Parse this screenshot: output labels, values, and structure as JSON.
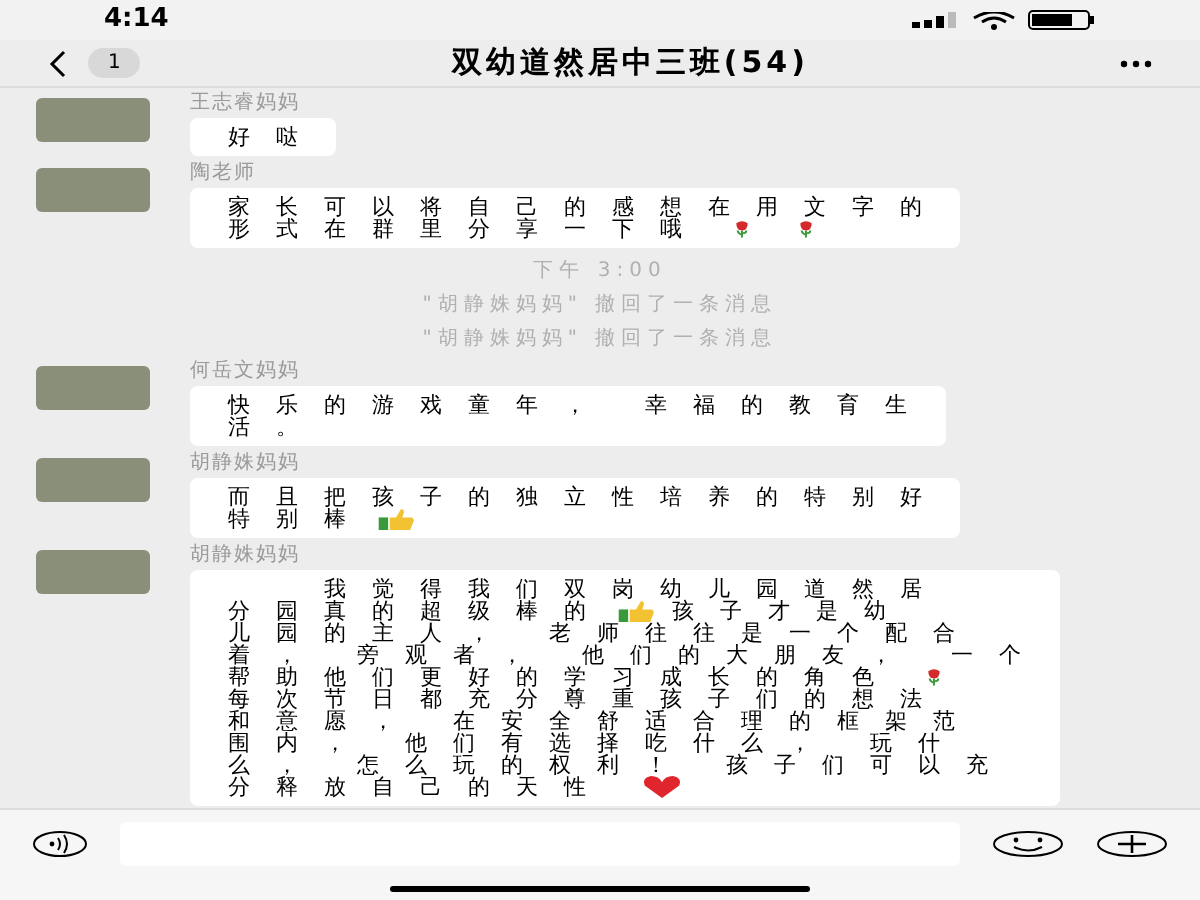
{
  "status_bar": {
    "time": "4:14"
  },
  "header": {
    "back_badge": "1",
    "title": "双幼道然居中三班(54)"
  },
  "messages": [
    {
      "kind": "message",
      "sender": "王志睿妈妈",
      "lines": [
        [
          {
            "kind": "text",
            "text": "好哒"
          }
        ]
      ]
    },
    {
      "kind": "message",
      "sender": "陶老师",
      "lines": [
        [
          {
            "kind": "text",
            "text": "家长可以将自己的感想在用文字的"
          }
        ],
        [
          {
            "kind": "text",
            "text": "形式在群里分享一下哦"
          },
          {
            "kind": "rose"
          },
          {
            "kind": "rose"
          }
        ]
      ]
    },
    {
      "kind": "time",
      "text": "下午 3:00"
    },
    {
      "kind": "notice",
      "text": "\"胡静姝妈妈\" 撤回了一条消息"
    },
    {
      "kind": "notice",
      "text": "\"胡静姝妈妈\" 撤回了一条消息"
    },
    {
      "kind": "message",
      "sender": "何岳文妈妈",
      "lines": [
        [
          {
            "kind": "text",
            "text": "快乐的游戏童年， 幸福的教育生"
          }
        ],
        [
          {
            "kind": "text",
            "text": "活。"
          }
        ]
      ]
    },
    {
      "kind": "message",
      "sender": "胡静姝妈妈",
      "lines": [
        [
          {
            "kind": "text",
            "text": "而且把孩子的独立性培养的特别好"
          }
        ],
        [
          {
            "kind": "text",
            "text": "特别棒"
          },
          {
            "kind": "thumbs"
          }
        ]
      ]
    },
    {
      "kind": "message",
      "sender": "胡静姝妈妈",
      "lines": [
        [
          {
            "kind": "text",
            "text": "　　我觉得我们双岗幼儿园道然居"
          }
        ],
        [
          {
            "kind": "text",
            "text": "分园真的超级棒的"
          },
          {
            "kind": "thumbs"
          },
          {
            "kind": "text",
            "text": "孩子才是幼"
          }
        ],
        [
          {
            "kind": "text",
            "text": "儿园的主人， 老师往往是一个配合"
          }
        ],
        [
          {
            "kind": "text",
            "text": "着， 旁观者， 他们的大朋友， 一个"
          }
        ],
        [
          {
            "kind": "text",
            "text": "帮助他们更好的学习成长的角色"
          },
          {
            "kind": "rose"
          }
        ],
        [
          {
            "kind": "text",
            "text": "每次节日都充分尊重孩子们的想法"
          }
        ],
        [
          {
            "kind": "text",
            "text": "和意愿， 在安全舒适合理的框架范"
          }
        ],
        [
          {
            "kind": "text",
            "text": "围内， 他们有选择吃什么， 玩什"
          }
        ],
        [
          {
            "kind": "text",
            "text": "么， 怎么玩的权利！ 孩子们可以充"
          }
        ],
        [
          {
            "kind": "text",
            "text": "分释放自己的天性"
          },
          {
            "kind": "heart"
          }
        ]
      ]
    }
  ]
}
